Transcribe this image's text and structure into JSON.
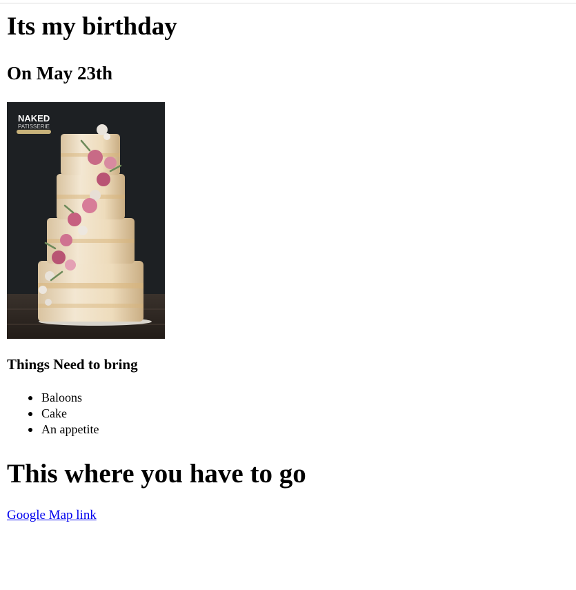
{
  "page": {
    "title": "Its my birthday",
    "subtitle": "On May 23th"
  },
  "photo": {
    "brand_line1": "NAKED",
    "brand_line2": "PATISSERIE"
  },
  "bring": {
    "heading": "Things Need to bring",
    "items": [
      "Baloons",
      "Cake",
      "An appetite"
    ]
  },
  "directions": {
    "heading": "This where you have to go",
    "link_label": "Google Map link"
  },
  "colors": {
    "link": "#0000ee",
    "text": "#000000",
    "photo_background": "#1b1d20"
  }
}
